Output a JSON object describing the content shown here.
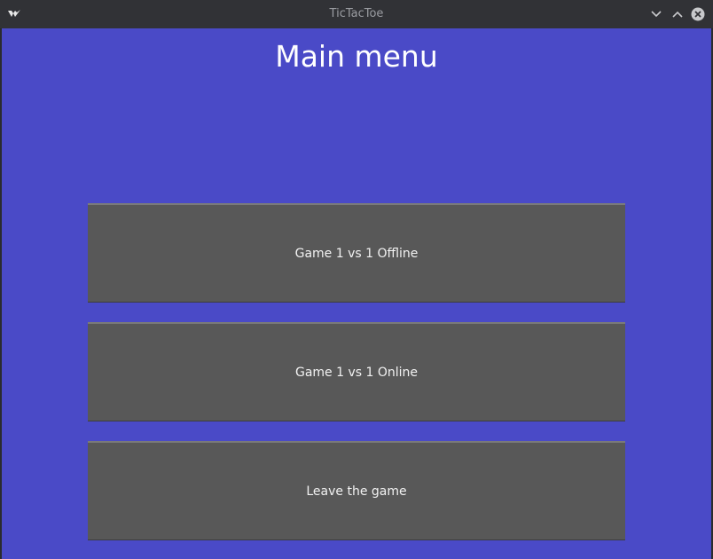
{
  "window": {
    "title": "TicTacToe"
  },
  "main": {
    "heading": "Main menu",
    "buttons": [
      {
        "label": "Game 1 vs 1 Offline"
      },
      {
        "label": "Game 1 vs 1 Online"
      },
      {
        "label": "Leave the game"
      }
    ]
  },
  "colors": {
    "background": "#4a4ac7",
    "button": "#585858",
    "titlebar": "#313236",
    "text": "#ffffff"
  },
  "icons": {
    "app": "kivy-logo-icon",
    "minimize": "chevron-down-icon",
    "maximize": "chevron-up-icon",
    "close": "close-icon"
  }
}
